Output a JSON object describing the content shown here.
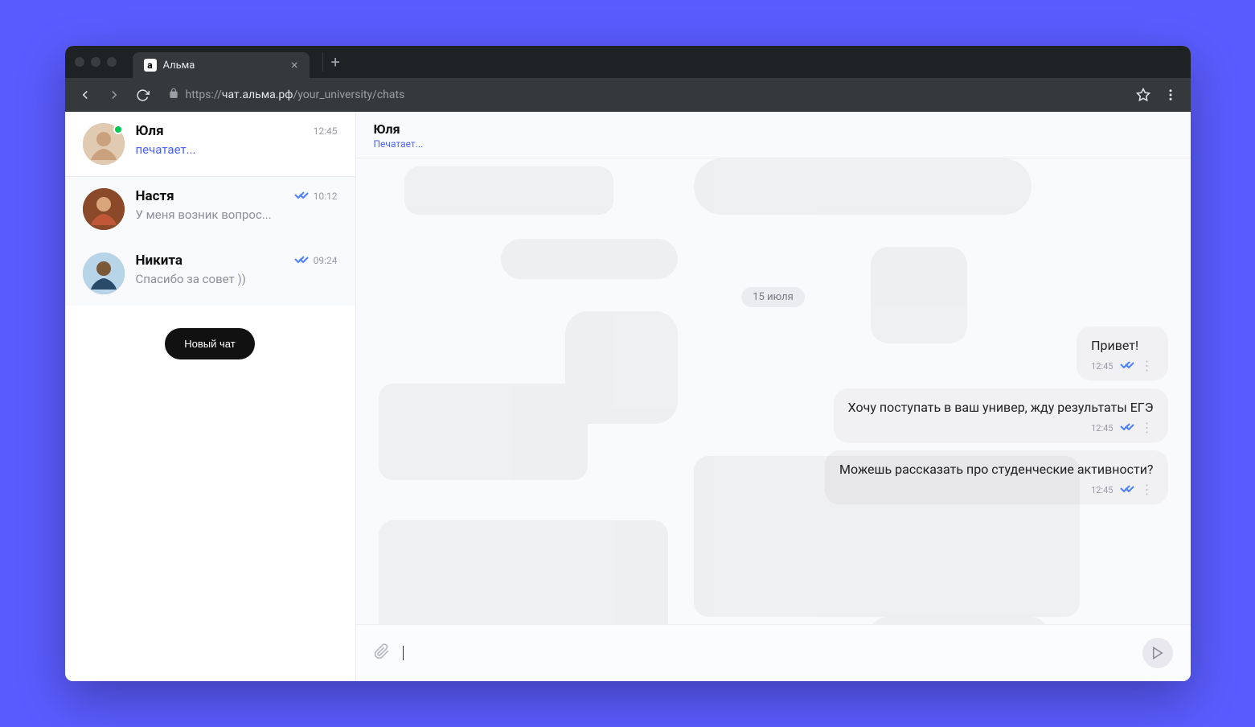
{
  "browser": {
    "tab_title": "Альма",
    "url_host": "чат.альма.рф",
    "url_protocol": "https://",
    "url_path": "/your_university/chats"
  },
  "sidebar": {
    "chats": [
      {
        "name": "Юля",
        "preview": "печатает...",
        "time": "12:45",
        "typing": true,
        "online": true,
        "read": false,
        "active": true
      },
      {
        "name": "Настя",
        "preview": "У меня возник вопрос...",
        "time": "10:12",
        "typing": false,
        "online": false,
        "read": true,
        "active": false
      },
      {
        "name": "Никита",
        "preview": "Спасибо за совет ))",
        "time": "09:24",
        "typing": false,
        "online": false,
        "read": true,
        "active": false
      }
    ],
    "new_chat_label": "Новый чат"
  },
  "conversation": {
    "header_name": "Юля",
    "header_status": "Печатает...",
    "date_label": "15 июля",
    "messages": [
      {
        "text": "Привет!",
        "time": "12:45",
        "read": true
      },
      {
        "text": "Хочу поступать в ваш универ, жду результаты ЕГЭ",
        "time": "12:45",
        "read": true
      },
      {
        "text": "Можешь рассказать про студенческие активности?",
        "time": "12:45",
        "read": true
      }
    ]
  }
}
